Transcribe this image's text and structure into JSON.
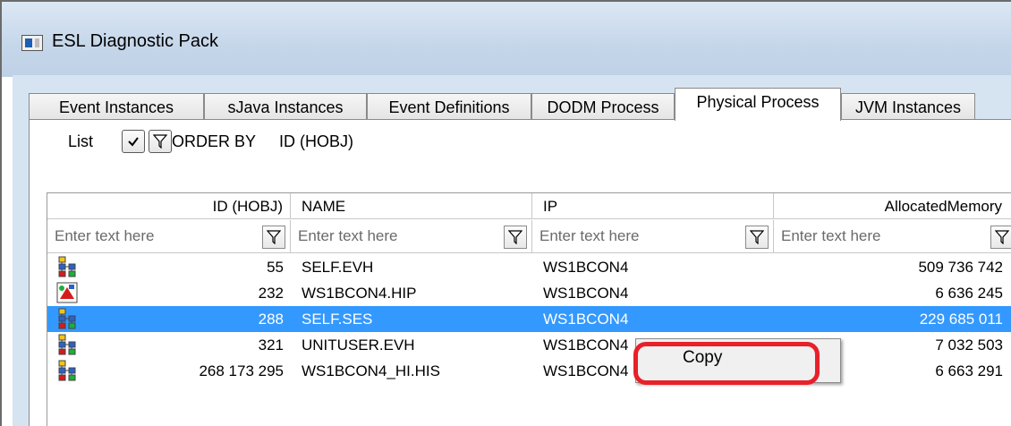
{
  "window": {
    "title": "ESL Diagnostic Pack"
  },
  "tabs": [
    {
      "label": "Event Instances"
    },
    {
      "label": "sJava Instances"
    },
    {
      "label": "Event Definitions"
    },
    {
      "label": "DODM Process"
    },
    {
      "label": "Physical Process",
      "active": true
    },
    {
      "label": "JVM Instances"
    }
  ],
  "toolbar": {
    "list_label": "List",
    "check_icon": "check-icon",
    "filter_icon": "funnel-icon",
    "order_by_label": "ORDER BY",
    "order_by_value": "ID (HOBJ)"
  },
  "grid": {
    "columns": [
      {
        "header": "ID (HOBJ)",
        "placeholder": "Enter text here"
      },
      {
        "header": "NAME",
        "placeholder": "Enter text here"
      },
      {
        "header": "IP",
        "placeholder": "Enter text here"
      },
      {
        "header": "AllocatedMemory",
        "placeholder": "Enter text here"
      }
    ],
    "rows": [
      {
        "icon": "process-tree-icon",
        "id": "55",
        "name": "SELF.EVH",
        "ip": "WS1BCON4",
        "memory": "509 736 742",
        "selected": false
      },
      {
        "icon": "hip-process-icon",
        "id": "232",
        "name": "WS1BCON4.HIP",
        "ip": "WS1BCON4",
        "memory": "6 636 245",
        "selected": false
      },
      {
        "icon": "process-tree-icon",
        "id": "288",
        "name": "SELF.SES",
        "ip": "WS1BCON4",
        "memory": "229 685 011",
        "selected": true
      },
      {
        "icon": "process-tree-icon",
        "id": "321",
        "name": "UNITUSER.EVH",
        "ip": "WS1BCON4",
        "memory": "7 032 503",
        "selected": false
      },
      {
        "icon": "process-tree-icon",
        "id": "268 173 295",
        "name": "WS1BCON4_HI.HIS",
        "ip": "WS1BCON4",
        "memory": "6 663 291",
        "selected": false
      }
    ]
  },
  "context_menu": {
    "items": [
      {
        "label": "Copy"
      }
    ]
  },
  "colors": {
    "selection": "#3399ff",
    "highlight_ring": "#e8202a",
    "client_bg": "#d6e4f2"
  }
}
